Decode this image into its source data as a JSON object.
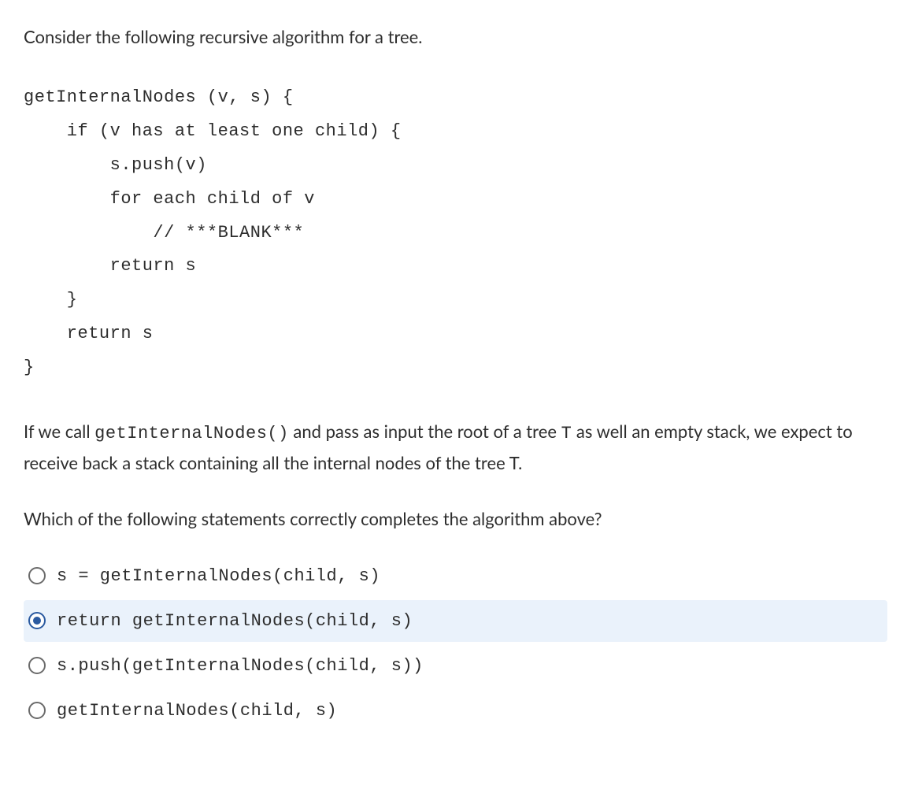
{
  "intro": "Consider the following recursive algorithm for a tree.",
  "code": "getInternalNodes (v, s) {\n    if (v has at least one child) {\n        s.push(v)\n        for each child of v\n            // ***BLANK***\n        return s\n    }\n    return s\n}",
  "explain_pre": "If we call ",
  "explain_code1": "getInternalNodes()",
  "explain_mid": " and pass as input the root of a tree ",
  "explain_code2": "T",
  "explain_post": " as well an empty stack, we expect to receive back a stack containing all the internal nodes of the  tree T.",
  "question": "Which of the following statements correctly completes the algorithm above?",
  "options": [
    {
      "label": "s = getInternalNodes(child, s)",
      "selected": false
    },
    {
      "label": "return getInternalNodes(child, s)",
      "selected": true
    },
    {
      "label": "s.push(getInternalNodes(child, s))",
      "selected": false
    },
    {
      "label": "getInternalNodes(child, s)",
      "selected": false
    }
  ]
}
